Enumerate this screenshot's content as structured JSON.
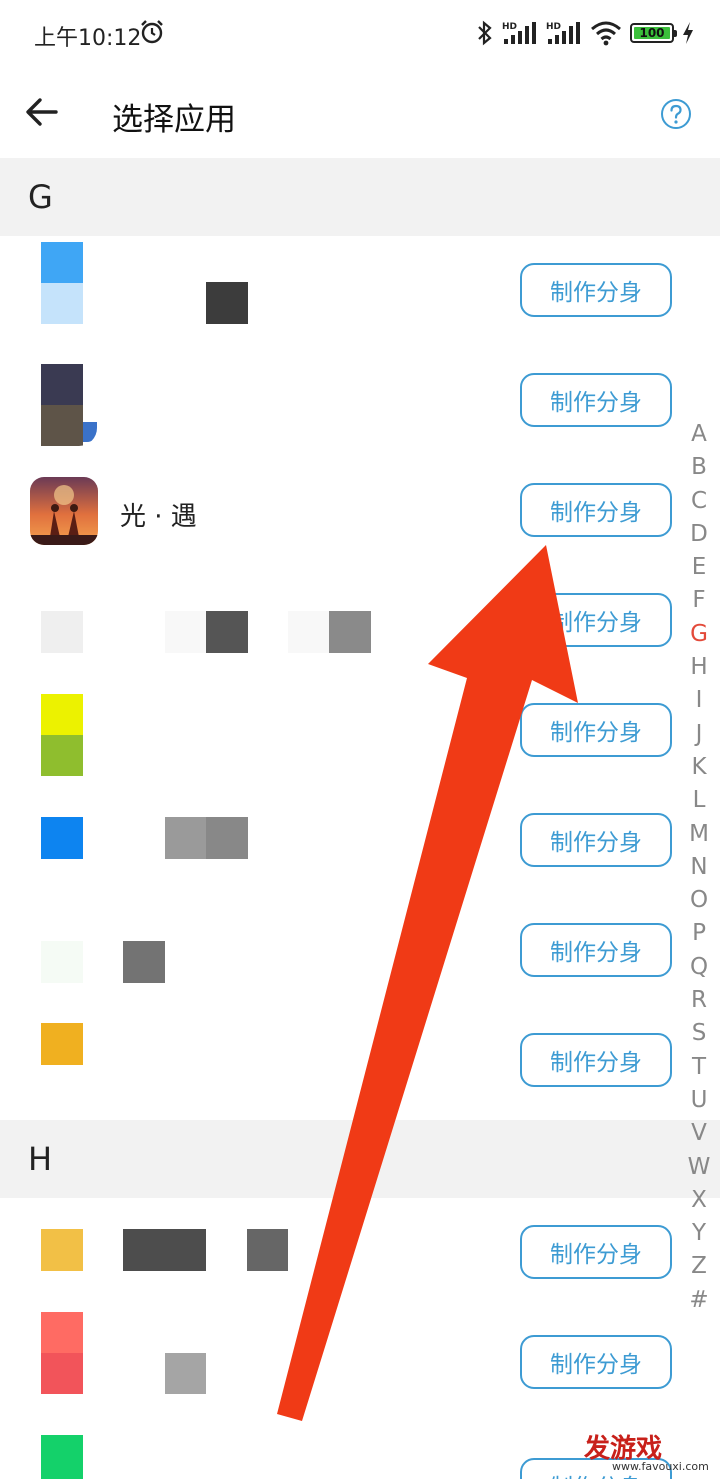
{
  "status": {
    "time": "上午10:12",
    "battery": "100",
    "hd1": "HD",
    "hd2": "HD"
  },
  "header": {
    "title": "选择应用"
  },
  "sections": {
    "g": "G",
    "h": "H"
  },
  "apps": {
    "guangyu": "光 · 遇"
  },
  "clone_label": "制作分身",
  "index": [
    "A",
    "B",
    "C",
    "D",
    "E",
    "F",
    "G",
    "H",
    "I",
    "J",
    "K",
    "L",
    "M",
    "N",
    "O",
    "P",
    "Q",
    "R",
    "S",
    "T",
    "U",
    "V",
    "W",
    "X",
    "Y",
    "Z",
    "#"
  ],
  "index_active": "G",
  "watermark": {
    "text": "发游戏",
    "url": "www.favouxi.com"
  },
  "colors": {
    "accent": "#3d9bd3",
    "arrow": "#f03a16",
    "index_active": "#e34a3a"
  }
}
